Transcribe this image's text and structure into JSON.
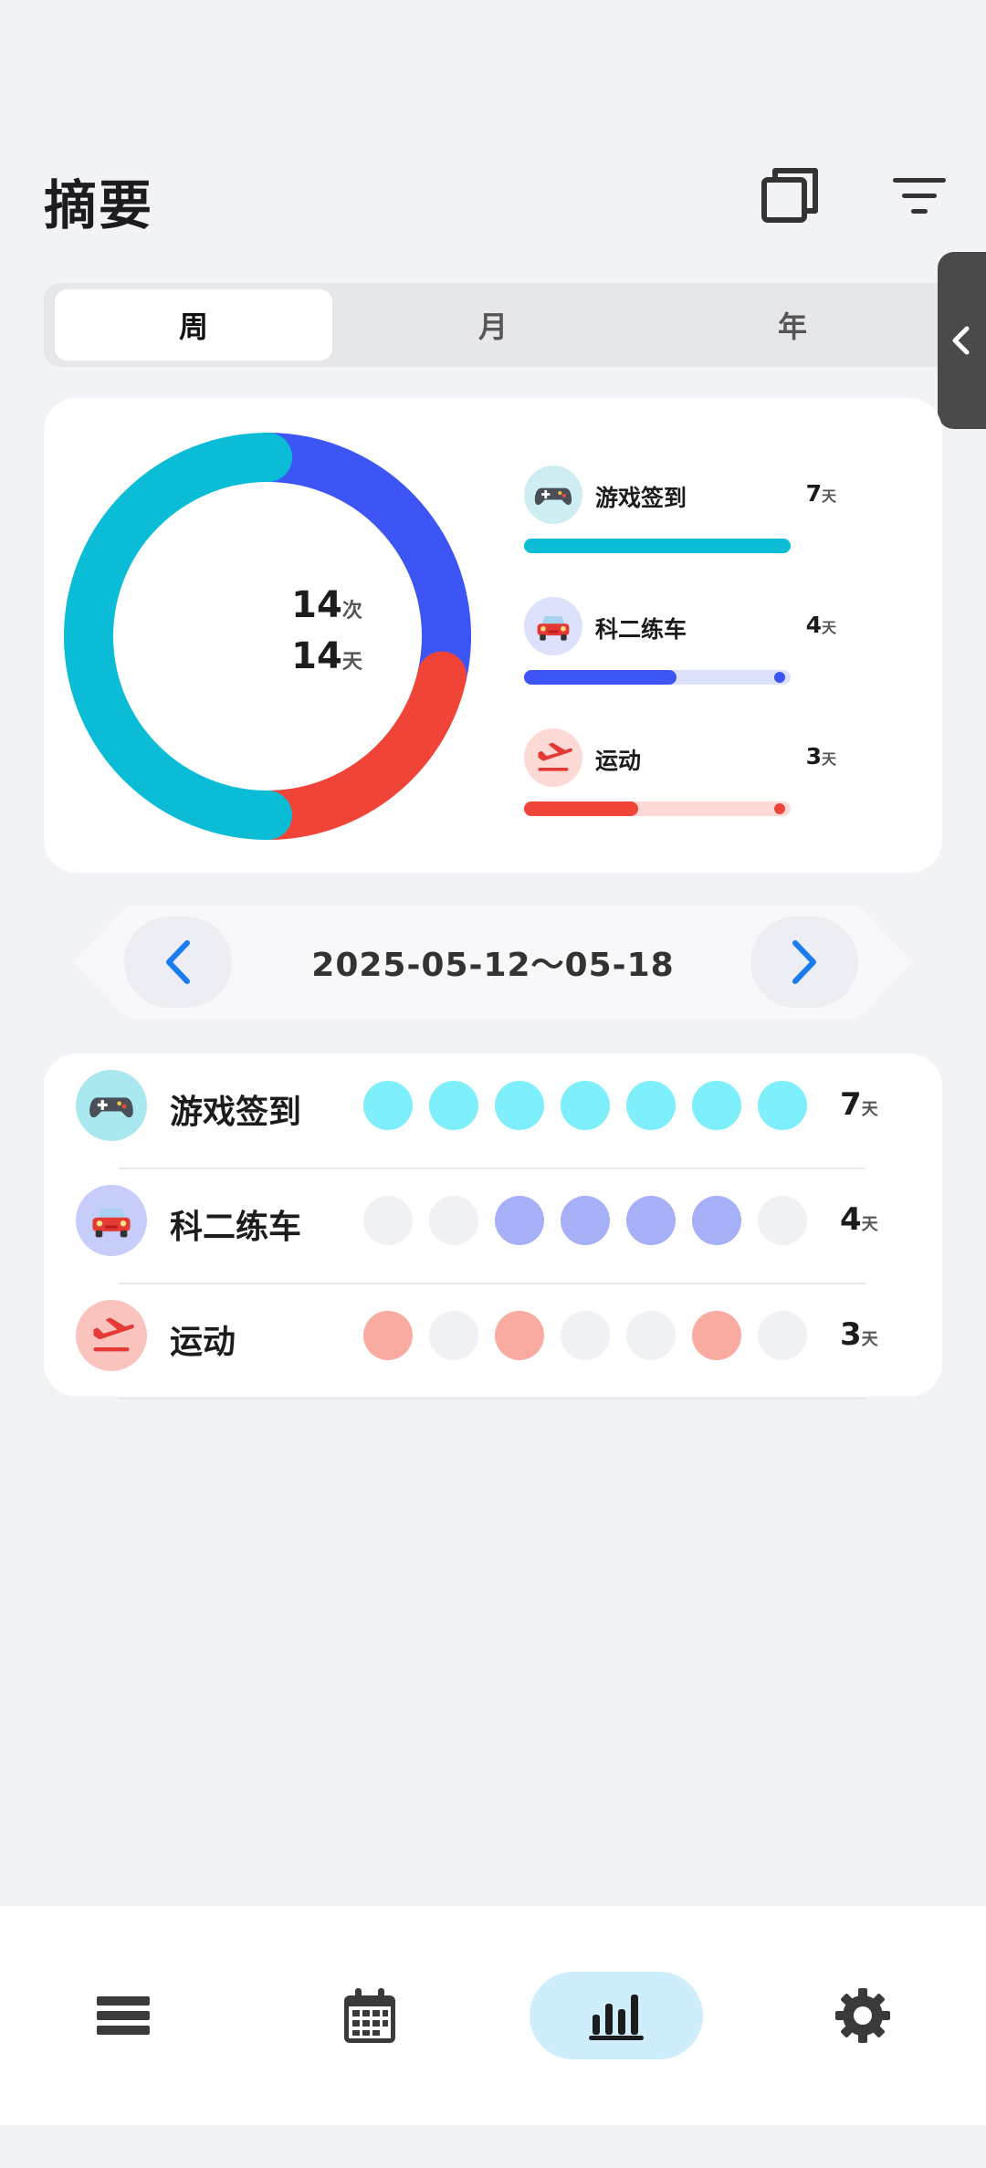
{
  "header": {
    "title": "摘要",
    "icons": [
      "copy-icon",
      "filter-icon"
    ]
  },
  "period_tabs": [
    {
      "label": "周",
      "active": true
    },
    {
      "label": "月",
      "active": false
    },
    {
      "label": "年",
      "active": false
    }
  ],
  "summary": {
    "total_times": "14",
    "times_unit": "次",
    "total_days": "14",
    "days_unit": "天",
    "items": [
      {
        "name": "游戏签到",
        "days": "7",
        "unit": "天",
        "icon": "gamepad-icon",
        "color": "#0bbcd6",
        "light": "#cfeef4",
        "ratio": 1.0
      },
      {
        "name": "科二练车",
        "days": "4",
        "unit": "天",
        "icon": "car-icon",
        "color": "#3d55f5",
        "light": "#dde1fb",
        "ratio": 0.571
      },
      {
        "name": "运动",
        "days": "3",
        "unit": "天",
        "icon": "plane-icon",
        "color": "#f04438",
        "light": "#fddad6",
        "ratio": 0.429
      }
    ]
  },
  "date_nav": {
    "range": "2025-05-12～05-18"
  },
  "habits": [
    {
      "name": "游戏签到",
      "days": "7",
      "unit": "天",
      "icon": "gamepad-icon",
      "icon_bg": "#a9e8ef",
      "dot_on": "#7ff0fb",
      "dots": [
        1,
        1,
        1,
        1,
        1,
        1,
        1
      ]
    },
    {
      "name": "科二练车",
      "days": "4",
      "unit": "天",
      "icon": "car-icon",
      "icon_bg": "#c7cdfb",
      "dot_on": "#a7b0f7",
      "dots": [
        0,
        0,
        1,
        1,
        1,
        1,
        0
      ]
    },
    {
      "name": "运动",
      "days": "3",
      "unit": "天",
      "icon": "plane-icon",
      "icon_bg": "#fbc3bd",
      "dot_on": "#f9aaa1",
      "dots": [
        1,
        0,
        1,
        0,
        0,
        1,
        0
      ]
    }
  ],
  "bottom_nav": [
    {
      "name": "list-icon",
      "active": false
    },
    {
      "name": "calendar-icon",
      "active": false
    },
    {
      "name": "chart-icon",
      "active": true
    },
    {
      "name": "gear-icon",
      "active": false
    }
  ]
}
